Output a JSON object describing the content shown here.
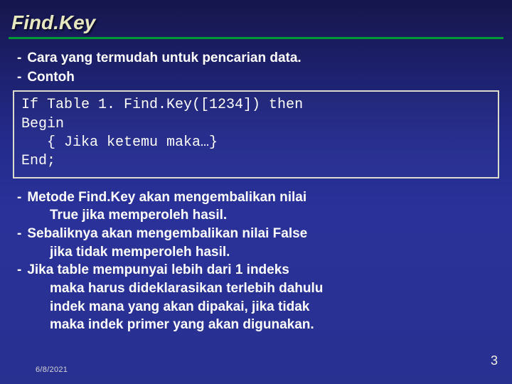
{
  "title": "Find.Key",
  "bullets_a": [
    "Cara yang termudah untuk pencarian data.",
    "Contoh"
  ],
  "code": {
    "l1": "If Table 1. Find.Key([1234]) then",
    "l2": "Begin",
    "l3": "{ Jika ketemu maka…}",
    "l4": "End;"
  },
  "bullets_b": [
    {
      "first": "Metode Find.Key akan mengembalikan nilai",
      "cont": [
        "True jika memperoleh hasil."
      ]
    },
    {
      "first": "Sebaliknya akan mengembalikan nilai False",
      "cont": [
        "jika tidak memperoleh hasil."
      ]
    },
    {
      "first": "Jika table mempunyai lebih dari 1 indeks",
      "cont": [
        "maka harus dideklarasikan terlebih dahulu",
        "indek mana yang akan dipakai, jika tidak",
        "maka indek primer yang akan digunakan."
      ]
    }
  ],
  "footer": {
    "date": "6/8/2021",
    "page": "3"
  },
  "dash": "-"
}
